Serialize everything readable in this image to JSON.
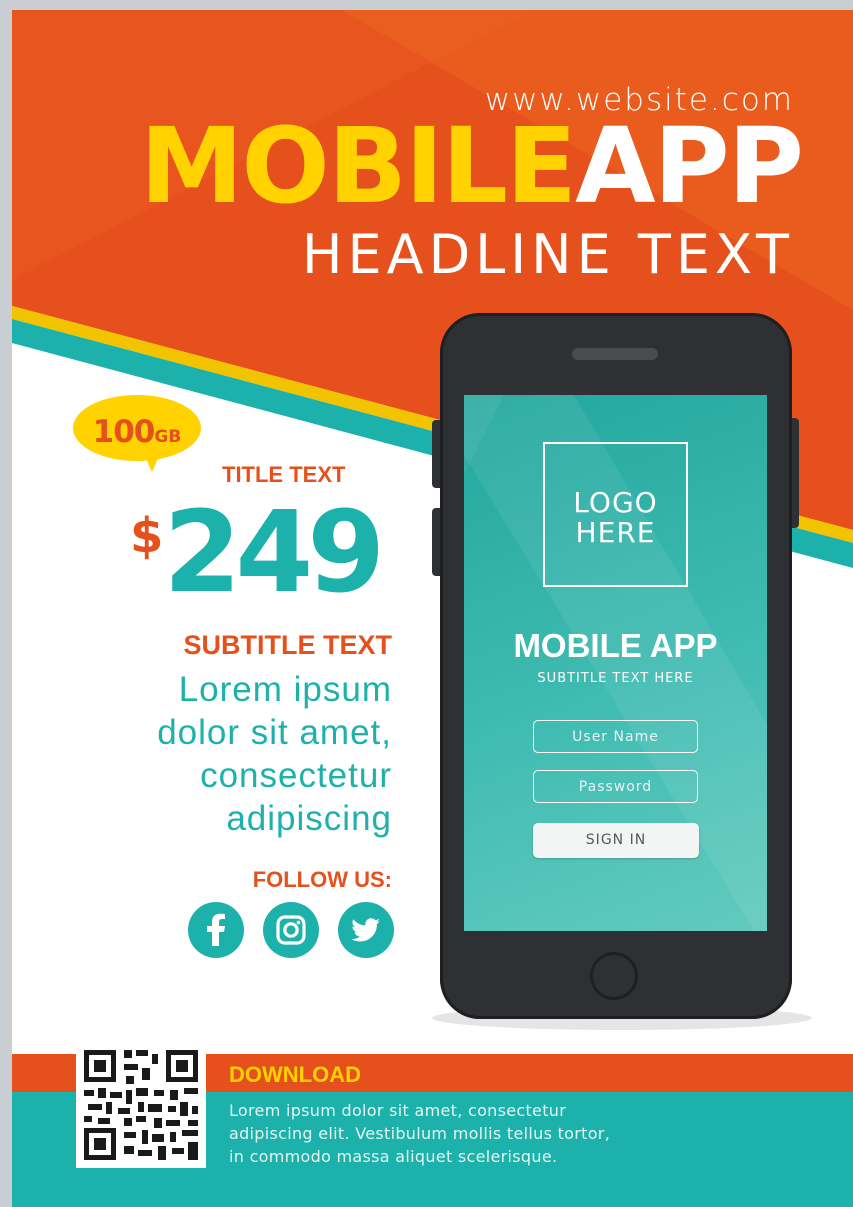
{
  "header": {
    "website": "www.website.com",
    "headline_part1": "MOBILE",
    "headline_part2": "APP",
    "subheadline": "HEADLINE TEXT"
  },
  "offer": {
    "badge_number": "100",
    "badge_unit": "GB",
    "title": "TITLE TEXT",
    "currency": "$",
    "price": "249",
    "subtitle": "SUBTITLE TEXT",
    "body_lines": [
      "Lorem ipsum",
      "dolor sit amet,",
      "consectetur",
      "adipiscing"
    ]
  },
  "social": {
    "label": "FOLLOW US:",
    "icons": [
      "facebook-icon",
      "instagram-icon",
      "twitter-icon"
    ]
  },
  "phone": {
    "logo_lines": [
      "LOGO",
      "HERE"
    ],
    "app_title": "MOBILE APP",
    "app_subtitle": "SUBTITLE TEXT HERE",
    "username_placeholder": "User Name",
    "password_placeholder": "Password",
    "signin_label": "SIGN IN"
  },
  "footer": {
    "download_label": "DOWNLOAD",
    "description_lines": [
      "Lorem ipsum dolor sit amet, consectetur",
      "adipiscing elit. Vestibulum mollis tellus tortor,",
      "in commodo massa aliquet scelerisque."
    ]
  },
  "colors": {
    "orange": "#e6501c",
    "yellow": "#ffd200",
    "teal": "#1db1ac",
    "phone_body": "#2f3033"
  }
}
